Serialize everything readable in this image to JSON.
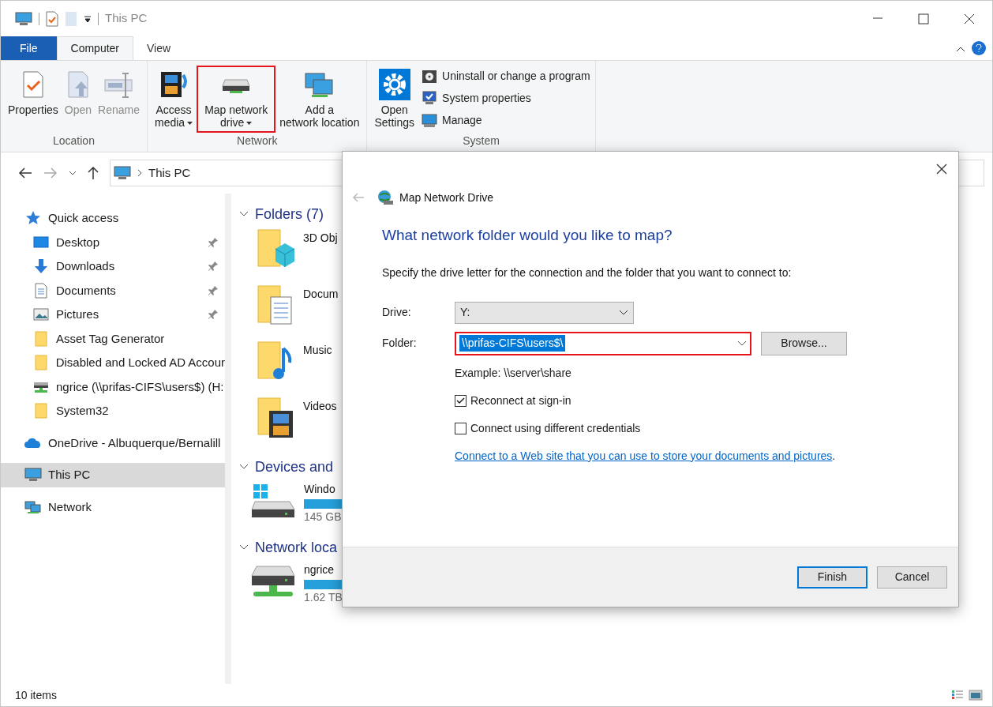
{
  "window": {
    "title": "This PC"
  },
  "ribbon_tabs": [
    {
      "label": "File",
      "kind": "file",
      "selected": false
    },
    {
      "label": "Computer",
      "kind": "tab",
      "selected": true
    },
    {
      "label": "View",
      "kind": "tab",
      "selected": false
    }
  ],
  "ribbon_groups": [
    {
      "label": "Location",
      "buttons": [
        {
          "label": "Properties",
          "kind": "properties",
          "disabled": false,
          "highlighted": false,
          "dropdown": false
        },
        {
          "label": "Open",
          "kind": "open",
          "disabled": true,
          "highlighted": false,
          "dropdown": false
        },
        {
          "label": "Rename",
          "kind": "rename",
          "disabled": true,
          "highlighted": false,
          "dropdown": false
        }
      ]
    },
    {
      "label": "Network",
      "buttons": [
        {
          "label": "Access media",
          "kind": "media",
          "disabled": false,
          "highlighted": false,
          "dropdown": true
        },
        {
          "label": "Map network drive",
          "kind": "drive",
          "disabled": false,
          "highlighted": true,
          "dropdown": true
        },
        {
          "label": "Add a network location",
          "kind": "netloc",
          "disabled": false,
          "highlighted": false,
          "dropdown": false
        }
      ]
    },
    {
      "label": "System",
      "buttons": [
        {
          "label": "Open Settings",
          "kind": "settings",
          "disabled": false,
          "highlighted": false,
          "dropdown": false
        }
      ],
      "small_buttons": [
        {
          "label": "Uninstall or change a program",
          "kind": "uninstall"
        },
        {
          "label": "System properties",
          "kind": "sysprops"
        },
        {
          "label": "Manage",
          "kind": "manage"
        }
      ]
    }
  ],
  "address_bar": {
    "path": "This PC"
  },
  "nav_pane": [
    {
      "label": "Quick access",
      "kind": "star",
      "selected": false,
      "children": [
        {
          "label": "Desktop",
          "kind": "desktop",
          "pinned": true,
          "selected": false
        },
        {
          "label": "Downloads",
          "kind": "download",
          "pinned": true,
          "selected": false
        },
        {
          "label": "Documents",
          "kind": "document",
          "pinned": true,
          "selected": false
        },
        {
          "label": "Pictures",
          "kind": "picture",
          "pinned": true,
          "selected": false
        },
        {
          "label": "Asset Tag Generator",
          "kind": "folder",
          "pinned": false,
          "selected": false
        },
        {
          "label": "Disabled and Locked AD Accour",
          "kind": "folder",
          "pinned": false,
          "selected": false
        },
        {
          "label": "ngrice (\\\\prifas-CIFS\\users$) (H:",
          "kind": "netdrive",
          "pinned": false,
          "selected": false
        },
        {
          "label": "System32",
          "kind": "folder",
          "pinned": false,
          "selected": false
        }
      ]
    },
    {
      "label": "OneDrive - Albuquerque/Bernalill",
      "kind": "cloud",
      "selected": false
    },
    {
      "label": "This PC",
      "kind": "pc",
      "selected": true
    },
    {
      "label": "Network",
      "kind": "network",
      "selected": false
    }
  ],
  "sections": [
    {
      "title": "Folders (7)",
      "items": [
        {
          "name": "3D Obj",
          "kind": "cube"
        },
        {
          "name": "Docum",
          "kind": "docfolder"
        },
        {
          "name": "Music",
          "kind": "music"
        },
        {
          "name": "Videos",
          "kind": "video"
        }
      ]
    },
    {
      "title": "Devices and",
      "items": [
        {
          "name": "Windo",
          "kind": "windrive",
          "detail": "145 GB"
        }
      ]
    },
    {
      "title": "Network loca",
      "items": [
        {
          "name": "ngrice",
          "kind": "netdrive",
          "detail": "1.62 TB"
        }
      ]
    }
  ],
  "status_bar": {
    "count": "10 items"
  },
  "dialog": {
    "title": "Map Network Drive",
    "heading": "What network folder would you like to map?",
    "instruction": "Specify the drive letter for the connection and the folder that you want to connect to:",
    "drive": {
      "label": "Drive:",
      "value": "Y:"
    },
    "folder": {
      "label": "Folder:",
      "value": "\\\\prifas-CIFS\\users$\\",
      "highlighted": true
    },
    "browse": "Browse...",
    "example": "Example: \\\\server\\share",
    "checkboxes": [
      {
        "label": "Reconnect at sign-in",
        "checked": true
      },
      {
        "label": "Connect using different credentials",
        "checked": false
      }
    ],
    "link": "Connect to a Web site that you can use to store your documents and pictures",
    "link_suffix": ".",
    "buttons": [
      {
        "label": "Finish",
        "default": true
      },
      {
        "label": "Cancel",
        "default": false
      }
    ]
  }
}
